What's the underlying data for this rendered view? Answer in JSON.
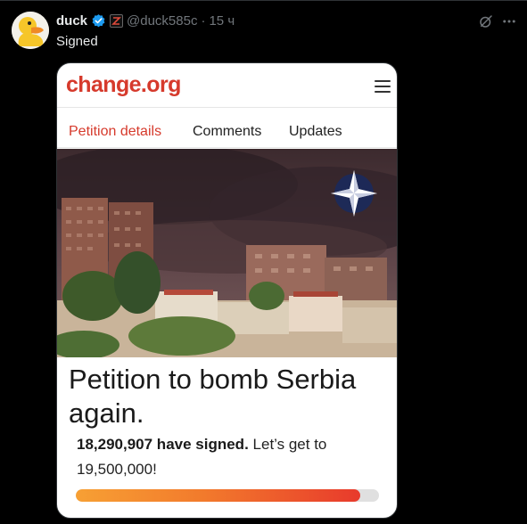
{
  "author": {
    "display_name": "duck",
    "handle": "@duck585c",
    "dot": "·",
    "timestamp": "15 ч",
    "verified": true
  },
  "post": {
    "text": "Signed"
  },
  "card": {
    "logo": "change.org",
    "tabs": [
      {
        "label": "Petition details",
        "active": true
      },
      {
        "label": "Comments",
        "active": false
      },
      {
        "label": "Updates",
        "active": false
      }
    ],
    "title": "Petition to bomb Serbia again.",
    "signed_count": "18,290,907 have signed.",
    "goal_text": "Let’s get to 19,500,000!",
    "progress_fraction": 0.938
  },
  "icons": {
    "grok": "grok-icon",
    "more": "more-icon",
    "menu": "hamburger-menu-icon"
  },
  "colors": {
    "background": "#000000",
    "brand_red": "#d63a2c",
    "verified_blue": "#1d9bf0",
    "muted_text": "#71767b"
  }
}
